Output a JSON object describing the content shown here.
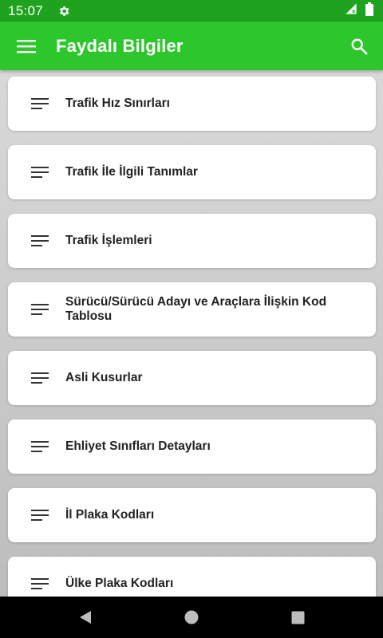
{
  "status_bar": {
    "time": "15:07"
  },
  "app_bar": {
    "title": "Faydalı Bilgiler"
  },
  "list": {
    "items": [
      {
        "label": "Trafik Hız Sınırları"
      },
      {
        "label": "Trafik İle İlgili Tanımlar"
      },
      {
        "label": "Trafik İşlemleri"
      },
      {
        "label": "Sürücü/Sürücü Adayı ve Araçlara İlişkin Kod Tablosu"
      },
      {
        "label": "Asli Kusurlar"
      },
      {
        "label": "Ehliyet Sınıfları Detayları"
      },
      {
        "label": "İl Plaka Kodları"
      },
      {
        "label": "Ülke Plaka Kodları"
      }
    ]
  },
  "colors": {
    "status_bar": "#1fa31f",
    "app_bar": "#2dc72d",
    "background": "#d0d0d0"
  }
}
